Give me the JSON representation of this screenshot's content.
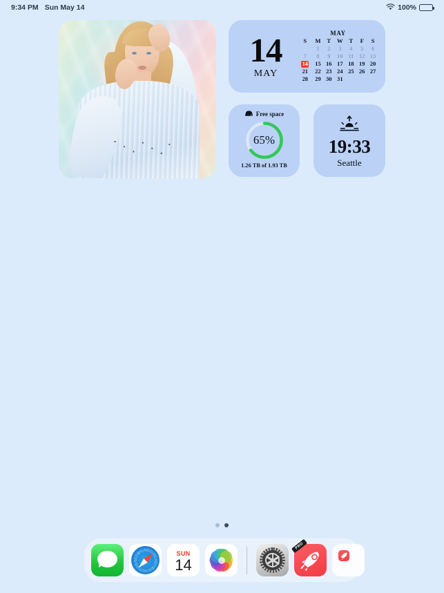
{
  "status_bar": {
    "time": "9:34 PM",
    "date": "Sun May 14",
    "wifi_icon": "wifi-icon",
    "battery_percent": "100%",
    "battery_icon": "battery-full-icon"
  },
  "widgets": {
    "photo": {
      "name": "Photos widget",
      "description": "Portrait photo of a blonde woman in a light blue knit sweater on a pastel gradient backdrop"
    },
    "calendar": {
      "day_number": "14",
      "month_short": "MAY",
      "month_title": "MAY",
      "weekday_headers": [
        "S",
        "M",
        "T",
        "W",
        "T",
        "F",
        "S"
      ],
      "weeks": [
        [
          {
            "d": "",
            "state": "empty"
          },
          {
            "d": "1",
            "state": "dim"
          },
          {
            "d": "2",
            "state": "dim"
          },
          {
            "d": "3",
            "state": "dim"
          },
          {
            "d": "4",
            "state": "dim"
          },
          {
            "d": "5",
            "state": "dim"
          },
          {
            "d": "6",
            "state": "dim"
          }
        ],
        [
          {
            "d": "7",
            "state": "dim"
          },
          {
            "d": "8",
            "state": "dim"
          },
          {
            "d": "9",
            "state": "dim"
          },
          {
            "d": "10",
            "state": "dim"
          },
          {
            "d": "11",
            "state": "dim"
          },
          {
            "d": "12",
            "state": "dim"
          },
          {
            "d": "13",
            "state": "dim"
          }
        ],
        [
          {
            "d": "14",
            "state": "today"
          },
          {
            "d": "15",
            "state": "normal"
          },
          {
            "d": "16",
            "state": "normal"
          },
          {
            "d": "17",
            "state": "normal"
          },
          {
            "d": "18",
            "state": "normal"
          },
          {
            "d": "19",
            "state": "normal"
          },
          {
            "d": "20",
            "state": "normal"
          }
        ],
        [
          {
            "d": "21",
            "state": "normal"
          },
          {
            "d": "22",
            "state": "normal"
          },
          {
            "d": "23",
            "state": "normal"
          },
          {
            "d": "24",
            "state": "normal"
          },
          {
            "d": "25",
            "state": "normal"
          },
          {
            "d": "26",
            "state": "normal"
          },
          {
            "d": "27",
            "state": "normal"
          }
        ],
        [
          {
            "d": "28",
            "state": "normal"
          },
          {
            "d": "29",
            "state": "normal"
          },
          {
            "d": "30",
            "state": "normal"
          },
          {
            "d": "31",
            "state": "normal"
          },
          {
            "d": "",
            "state": "empty"
          },
          {
            "d": "",
            "state": "empty"
          },
          {
            "d": "",
            "state": "empty"
          }
        ]
      ],
      "today_highlight_color": "#f43d2c"
    },
    "free_space": {
      "title": "Free space",
      "icon": "hard-drive-icon",
      "percent_label": "65%",
      "percent_value": 65,
      "caption": "1.26 TB of 1.93 TB",
      "arc_color": "#33c85a",
      "track_color": "#dbe8fa"
    },
    "sunrise": {
      "icon": "sunrise-icon",
      "time": "19:33",
      "city": "Seattle"
    }
  },
  "page_dots": {
    "count": 2,
    "active_index": 1
  },
  "dock": {
    "apps": [
      {
        "name": "messages-app",
        "label": "Messages",
        "icon": "messages-icon"
      },
      {
        "name": "safari-app",
        "label": "Safari",
        "icon": "safari-compass-icon"
      },
      {
        "name": "calendar-app",
        "label": "Calendar",
        "icon": "calendar-icon",
        "weekday": "SUN",
        "day": "14"
      },
      {
        "name": "photos-app",
        "label": "Photos",
        "icon": "photos-pinwheel-icon"
      },
      {
        "name": "settings-app",
        "label": "Settings",
        "icon": "gear-icon"
      },
      {
        "name": "rocket-pro-app",
        "label": "Rocket Pro",
        "icon": "rocket-icon",
        "badge": "PRO"
      },
      {
        "name": "rocket-lite-app",
        "label": "Rocket",
        "icon": "rocket-small-icon"
      }
    ]
  },
  "colors": {
    "wallpaper": "#dcebfb",
    "widget_bg": "#bbd2f6",
    "accent_red": "#f43d2c",
    "accent_green": "#33c85a"
  }
}
